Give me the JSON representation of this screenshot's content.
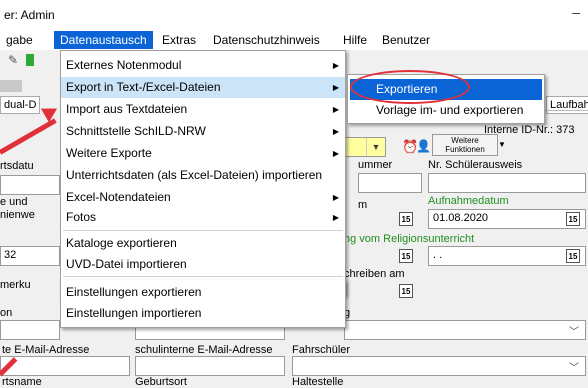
{
  "window": {
    "title": "er: Admin",
    "minimize": "–"
  },
  "menubar": {
    "items": [
      "gabe",
      "Datenaustausch",
      "Extras",
      "Datenschutzhinweis",
      "Hilfe",
      "Benutzer"
    ]
  },
  "main_menu": {
    "items": [
      {
        "label": "Externes Notenmodul",
        "sub": true
      },
      {
        "label": "Export in Text-/Excel-Dateien",
        "sub": true
      },
      {
        "label": "Import aus Textdateien",
        "sub": true
      },
      {
        "label": "Schnittstelle SchILD-NRW",
        "sub": true
      },
      {
        "label": "Weitere Exporte",
        "sub": true
      },
      {
        "label": "Unterrichtsdaten (als Excel-Dateien) importieren",
        "sub": false
      },
      {
        "label": "Excel-Notendateien",
        "sub": true
      },
      {
        "label": "Fotos",
        "sub": true
      },
      {
        "label": "Kataloge exportieren",
        "sub": false
      },
      {
        "label": "UVD-Datei importieren",
        "sub": false
      },
      {
        "label": "Einstellungen exportieren",
        "sub": false
      },
      {
        "label": "Einstellungen importieren",
        "sub": false
      }
    ],
    "arrow_glyph": "▶"
  },
  "sub_menu": {
    "items": [
      "Exportieren",
      "Vorlage im- und exportieren"
    ]
  },
  "tabs": {
    "left": "dual-D",
    "right": "Laufbah"
  },
  "form": {
    "interne_id": "Interne ID-Nr.: 373",
    "weitere_funktionen": "Weitere Funktionen",
    "labels": {
      "ummer": "ummer",
      "schuelerausweis": "Nr. Schülerausweis",
      "aufnahmedatum": "Aufnahmedatum",
      "m": "m",
      "religion": "ng vom Religionsunterricht",
      "schreiben": "chreiben am",
      "g": "g",
      "email": "te E-Mail-Adresse",
      "schul_email": "schulinterne E-Mail-Adresse",
      "fahrschueler": "Fahrschüler",
      "rtsname": "rtsname",
      "geburtsort": "Geburtsort",
      "haltestelle": "Haltestelle",
      "left_labels": [
        "rtsdatu",
        "e und",
        "nienwe",
        "merku",
        "on"
      ]
    },
    "values": {
      "aufnahmedatum": "01.08.2020",
      "religion_date": " .  .",
      "left_value": "32"
    },
    "cal_glyph": "15"
  }
}
